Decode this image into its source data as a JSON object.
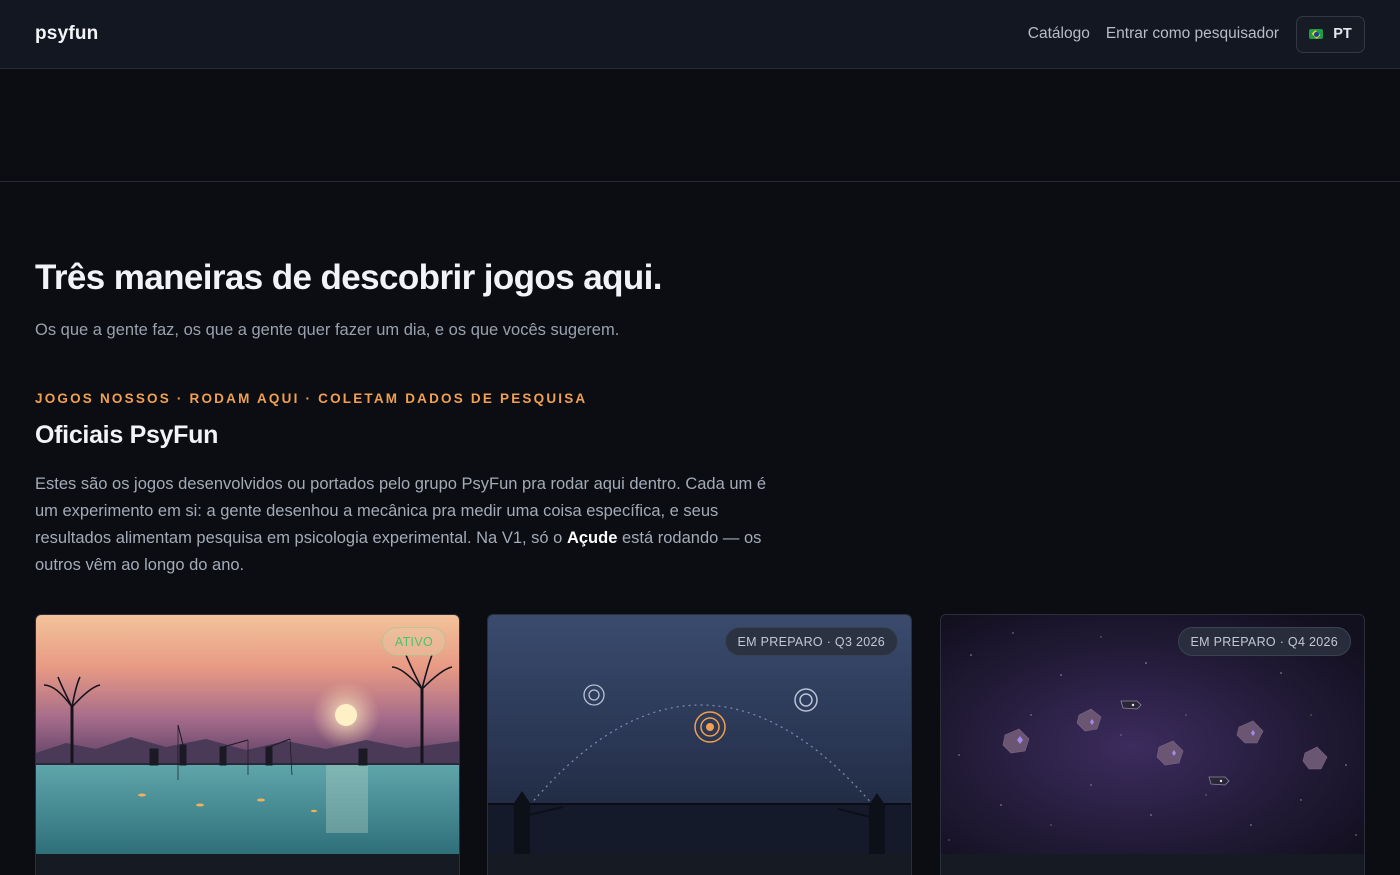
{
  "nav": {
    "brand": "psyfun",
    "links": [
      "Catálogo",
      "Entrar como pesquisador"
    ],
    "language": "PT"
  },
  "upper": {
    "cutoff_text": "... ... ... ... ..."
  },
  "section": {
    "title": "Três maneiras de descobrir jogos aqui.",
    "subtitle": "Os que a gente faz, os que a gente quer fazer um dia, e os que vocês sugerem.",
    "eyebrow": "JOGOS NOSSOS · RODAM AQUI · COLETAM DADOS DE PESQUISA",
    "heading": "Oficiais PsyFun",
    "paragraph_before": "Estes são os jogos desenvolvidos ou portados pelo grupo PsyFun pra rodar aqui dentro. Cada um é um experimento em si: a gente desenhou a mecânica pra medir uma coisa específica, e seus resultados alimentam pesquisa em psicologia experimental. Na V1, só o ",
    "paragraph_bold": "Açude",
    "paragraph_after": " está rodando — os outros vêm ao longo do ano."
  },
  "cards": [
    {
      "badge": "ATIVO",
      "status": "active",
      "art": "lake-sunset"
    },
    {
      "badge": "EM PREPARO · Q3 2026",
      "status": "soon",
      "art": "night-targets"
    },
    {
      "badge": "EM PREPARO · Q4 2026",
      "status": "soon",
      "art": "space-asteroids"
    }
  ],
  "colors": {
    "accent": "#f0a050",
    "active_badge": "#4cc46a",
    "background": "#0b0d12",
    "nav_background": "#131722"
  }
}
